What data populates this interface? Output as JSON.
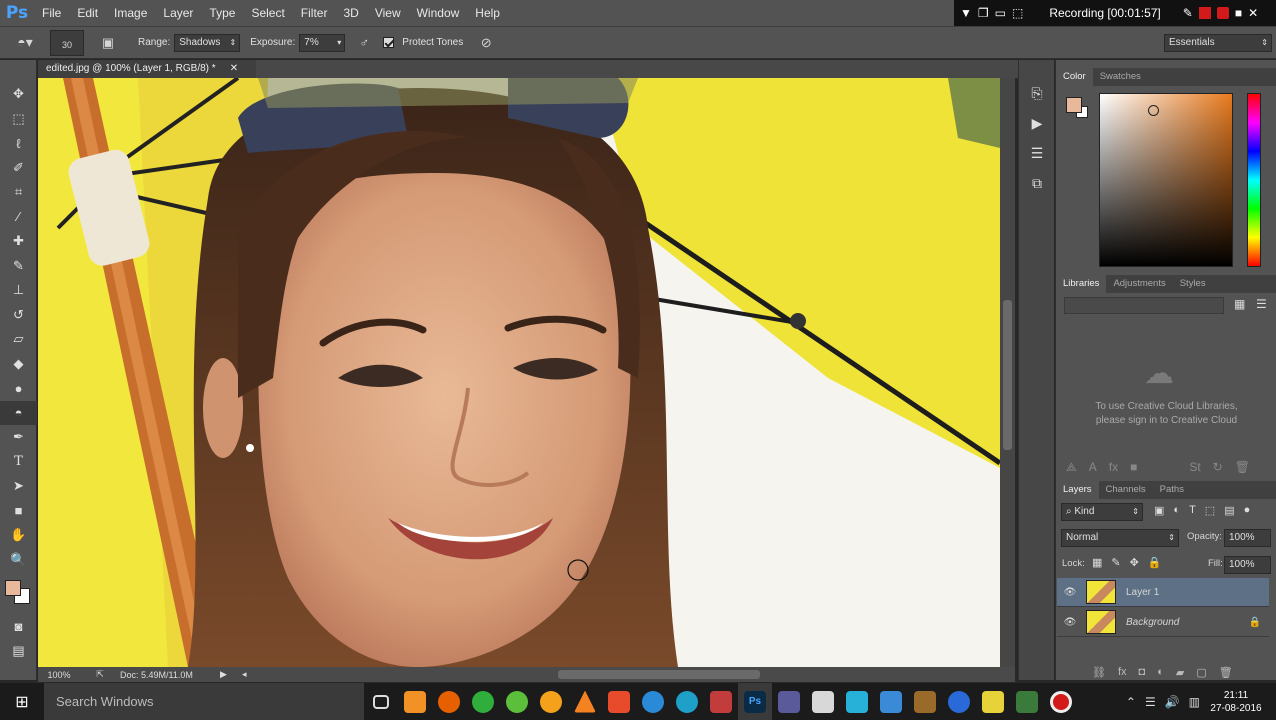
{
  "app": {
    "logo": "Ps",
    "menu": [
      "File",
      "Edit",
      "Image",
      "Layer",
      "Type",
      "Select",
      "Filter",
      "3D",
      "View",
      "Window",
      "Help"
    ]
  },
  "recording": {
    "text": "Recording [00:01:57]"
  },
  "options": {
    "brush_size": "30",
    "range_label": "Range:",
    "range_value": "Shadows",
    "exposure_label": "Exposure:",
    "exposure_value": "7%",
    "protect_tones": "Protect Tones",
    "workspace": "Essentials"
  },
  "document": {
    "tab_title": "edited.jpg @ 100% (Layer 1, RGB/8) *",
    "zoom": "100%",
    "doc_size": "Doc: 5.49M/11.0M"
  },
  "color_panel": {
    "tabs": [
      "Color",
      "Swatches"
    ],
    "foreground": "#e8b89a",
    "background": "#ffffff",
    "hue_accent": "#e87a1e"
  },
  "libraries": {
    "tabs": [
      "Libraries",
      "Adjustments",
      "Styles"
    ],
    "message_line1": "To use Creative Cloud Libraries,",
    "message_line2": "please sign in to Creative Cloud"
  },
  "layers": {
    "tabs": [
      "Layers",
      "Channels",
      "Paths"
    ],
    "kind": "Kind",
    "blend_mode": "Normal",
    "opacity_label": "Opacity:",
    "opacity_value": "100%",
    "lock_label": "Lock:",
    "fill_label": "Fill:",
    "fill_value": "100%",
    "items": [
      {
        "name": "Layer 1",
        "selected": true
      },
      {
        "name": "Background",
        "locked": true
      }
    ]
  },
  "taskbar": {
    "search_placeholder": "Search Windows",
    "time": "21:11",
    "date": "27-08-2016"
  },
  "colors": {
    "ui_bg": "#535353",
    "canvas_yellow": "#f2e53a",
    "selection": "#5d7085"
  }
}
